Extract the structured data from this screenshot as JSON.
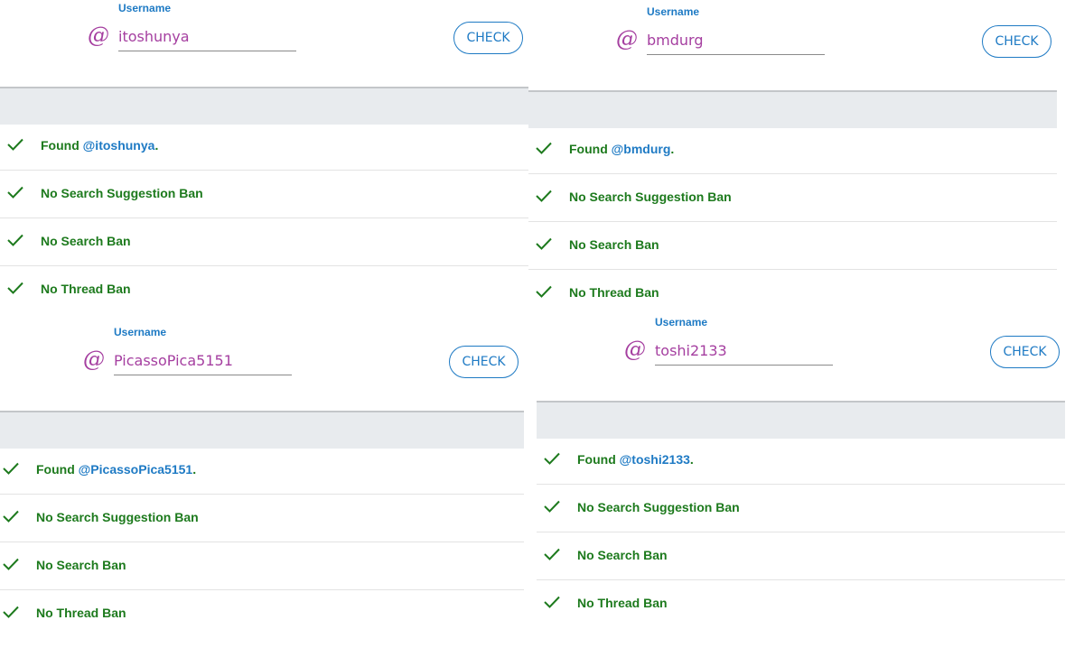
{
  "colors": {
    "accent": "#1e7ac4",
    "handle": "#a53fa0",
    "success": "#1d7a1d",
    "divider": "#e8ebee"
  },
  "icons": {
    "at": "@",
    "check": "check-icon"
  },
  "panels": [
    {
      "label": "Username",
      "at_symbol": "@",
      "username": "itoshunya",
      "button": "CHECK",
      "found_prefix": "Found",
      "found_handle": "@itoshunya",
      "found_suffix": ".",
      "results": [
        "No Search Suggestion Ban",
        "No Search Ban",
        "No Thread Ban"
      ]
    },
    {
      "label": "Username",
      "at_symbol": "@",
      "username": "bmdurg",
      "button": "CHECK",
      "found_prefix": "Found",
      "found_handle": "@bmdurg",
      "found_suffix": ".",
      "results": [
        "No Search Suggestion Ban",
        "No Search Ban",
        "No Thread Ban"
      ]
    },
    {
      "label": "Username",
      "at_symbol": "@",
      "username": "PicassoPica5151",
      "button": "CHECK",
      "found_prefix": "Found",
      "found_handle": "@PicassoPica5151",
      "found_suffix": ".",
      "results": [
        "No Search Suggestion Ban",
        "No Search Ban",
        "No Thread Ban"
      ]
    },
    {
      "label": "Username",
      "at_symbol": "@",
      "username": "toshi2133",
      "button": "CHECK",
      "found_prefix": "Found",
      "found_handle": "@toshi2133",
      "found_suffix": ".",
      "results": [
        "No Search Suggestion Ban",
        "No Search Ban",
        "No Thread Ban"
      ]
    }
  ]
}
